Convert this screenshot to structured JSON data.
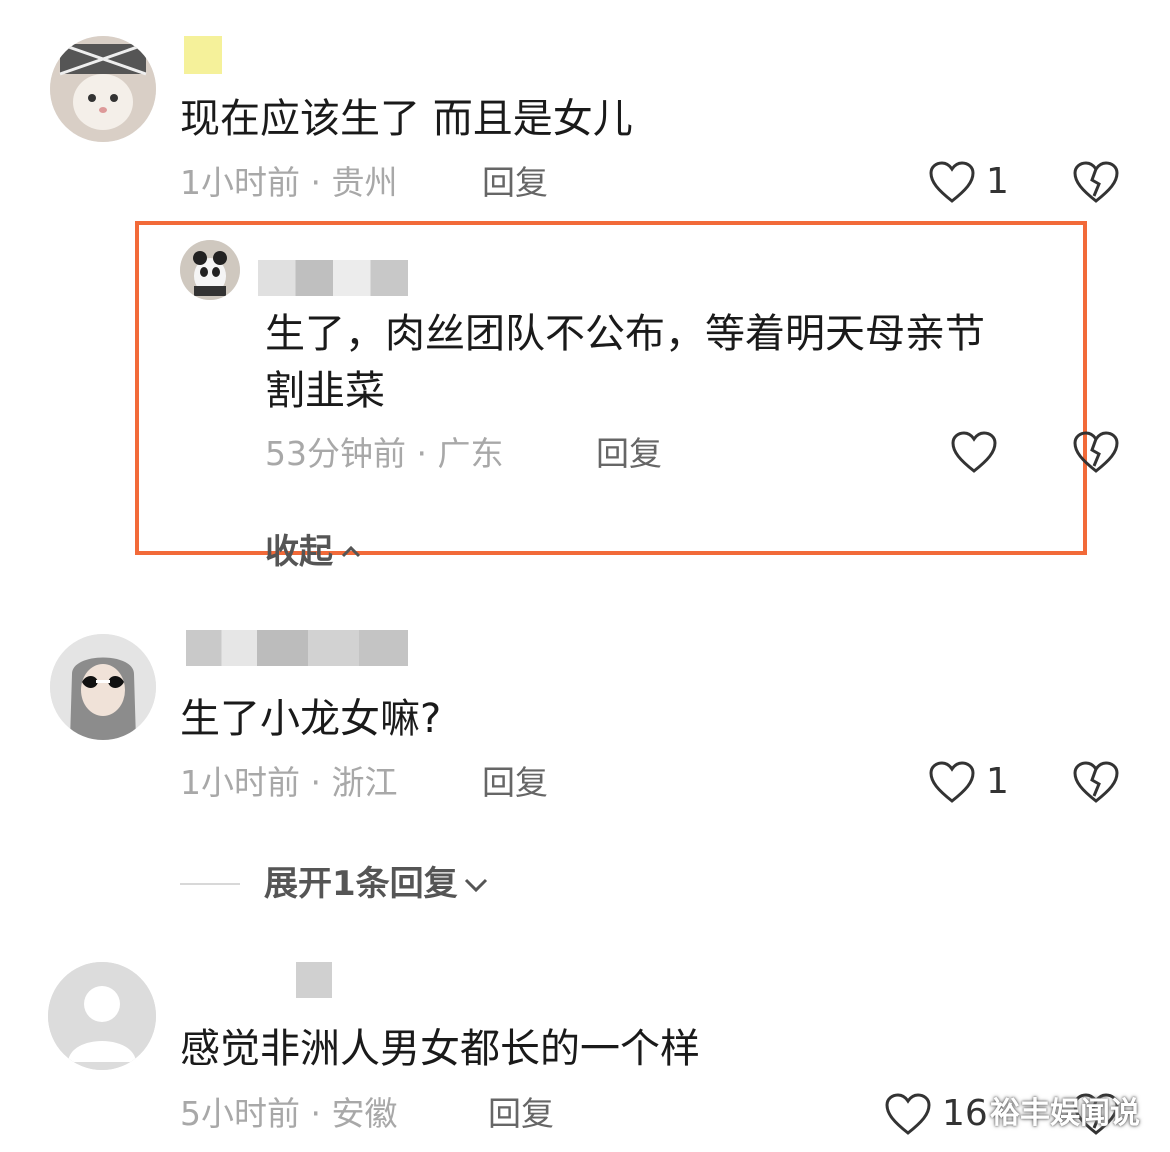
{
  "comments": [
    {
      "text": "现在应该生了 而且是女儿",
      "meta": "1小时前 · 贵州",
      "reply": "回复",
      "likes": "1"
    },
    {
      "text_line1": "生了，肉丝团队不公布，等着明天母亲节",
      "text_line2": "割韭菜",
      "meta": "53分钟前 · 广东",
      "reply": "回复",
      "likes": ""
    },
    {
      "text": "生了小龙女嘛?",
      "meta": "1小时前 · 浙江",
      "reply": "回复",
      "likes": "1"
    },
    {
      "text": "感觉非洲人男女都长的一个样",
      "meta": "5小时前 · 安徽",
      "reply": "回复",
      "likes": "16"
    }
  ],
  "collapse_label": "收起",
  "expand_label": "展开1条回复",
  "watermark": "裕丰娱闻说",
  "colors": {
    "highlight": "#f26a39",
    "meta_text": "#a8a8a8",
    "body_text": "#1a1a1a"
  },
  "icons": [
    "heart-outline-icon",
    "broken-heart-icon",
    "chevron-up-icon",
    "chevron-down-icon"
  ]
}
